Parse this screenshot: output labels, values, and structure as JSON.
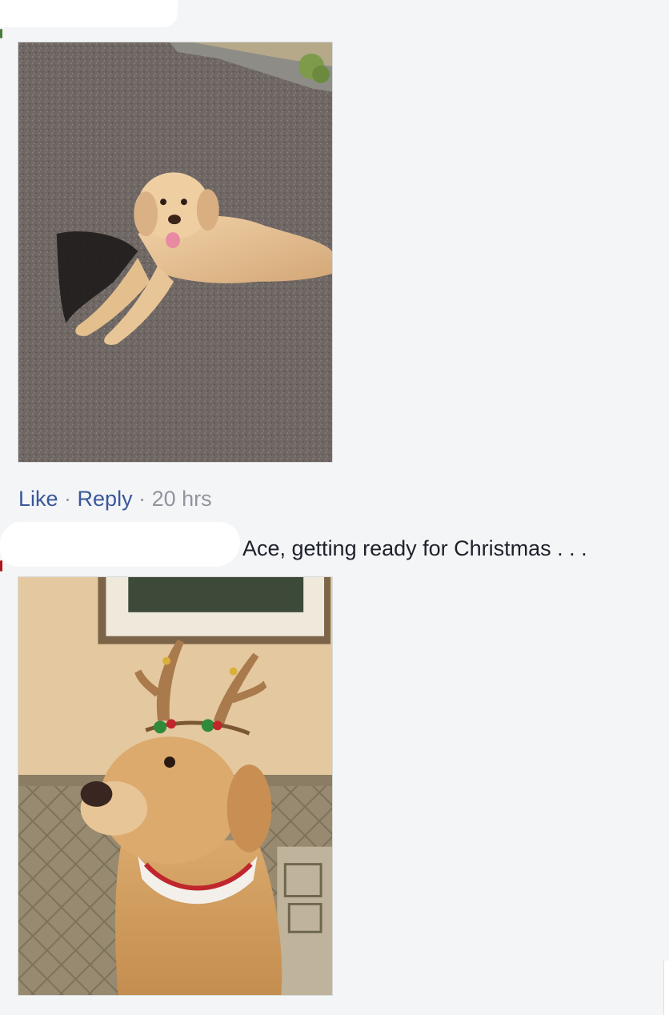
{
  "comment1": {
    "photo": {
      "subject": "dog-lying-on-pavement"
    },
    "actions": {
      "like_label": "Like",
      "separator": "·",
      "reply_label": "Reply",
      "timestamp": "20 hrs"
    }
  },
  "comment2": {
    "text": "Ace, getting ready for Christmas . . .",
    "photo": {
      "subject": "dog-wearing-reindeer-antlers"
    }
  },
  "colors": {
    "background": "#f4f5f7",
    "link": "#385898",
    "meta": "#90949c",
    "text": "#1d2129"
  }
}
